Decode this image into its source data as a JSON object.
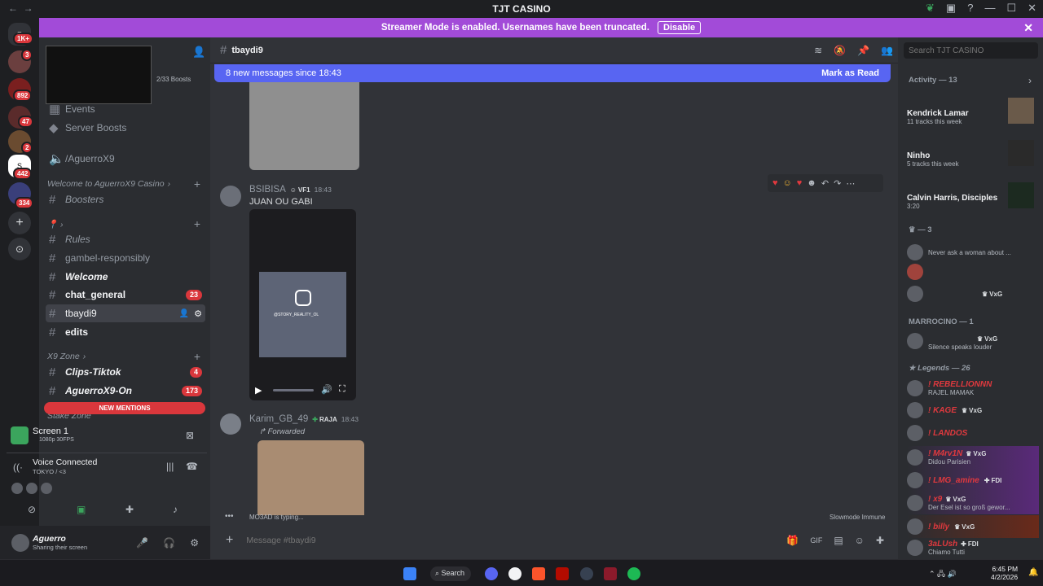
{
  "window": {
    "title": "TJT CASINO"
  },
  "banner": {
    "text": "Streamer Mode is enabled. Usernames have been truncated.",
    "disable_label": "Disable"
  },
  "rail": {
    "home_badge": "1K+",
    "badges": [
      "3",
      "892",
      "47",
      "2",
      "442",
      "334"
    ]
  },
  "sidebar": {
    "boosts": "2/33 Boosts",
    "items": {
      "events": "Events",
      "server_boosts": "Server Boosts",
      "aguerro": "/AguerroX9",
      "cat_welcome": "Welcome to AguerroX9 Casino",
      "boosters": "Boosters",
      "rules": "Rules",
      "gambel": "gambel-responsibly",
      "welcome": "Welcome",
      "chat_general": "chat_general",
      "chat_general_count": "23",
      "tbaydi9": "tbaydi9",
      "edits": "edits",
      "cat_x9": "X9 Zone",
      "clips": "Clips-Tiktok",
      "clips_count": "4",
      "aguerro_on": "AguerroX9-On",
      "aguerro_on_count": "173",
      "new_mentions": "NEW MENTIONS",
      "stake_zone": "Stake Zone"
    },
    "screen": {
      "title": "Screen 1",
      "quality": "1080p 30FPS"
    },
    "voice": {
      "status": "Voice Connected",
      "channel": "TOKYO / <3"
    },
    "user": {
      "name": "Aguerro",
      "status": "Sharing their screen"
    }
  },
  "main": {
    "channel": "tbaydi9",
    "new_messages": "8 new messages since 18:43",
    "mark_read": "Mark as Read",
    "msg1": {
      "author": "BSIBISA",
      "tag": "VF1",
      "time": "18:43",
      "text": "JUAN OU GABI",
      "video_caption": "@STORY_REALITY_OL"
    },
    "msg2": {
      "author": "Karim_GB_49",
      "tag": "RAJA",
      "time": "18:43",
      "forwarded": "Forwarded"
    },
    "typing": "MO3AD is typing...",
    "slowmode": "Slowmode Immune",
    "composer_placeholder": "Message #tbaydi9"
  },
  "members": {
    "search_placeholder": "Search TJT CASINO",
    "activity_header": "Activity — 13",
    "activities": [
      {
        "name": "Kendrick Lamar",
        "sub": "11 tracks this week"
      },
      {
        "name": "Ninho",
        "sub": "5 tracks this week"
      },
      {
        "name": "Calvin Harris, Disciples",
        "sub": "3:20"
      }
    ],
    "group3": "— 3",
    "g3_members": [
      {
        "name": "",
        "sub": "Never ask a woman about ..."
      },
      {
        "name": "",
        "sub": ""
      },
      {
        "name": "",
        "tag": "VxG",
        "sub": ""
      }
    ],
    "marrocino_header": "MARROCINO — 1",
    "marrocino": {
      "tag": "VxG",
      "sub": "Silence speaks louder"
    },
    "legends_header": "Legends — 26",
    "legends": [
      {
        "name": "! REBELLIONNN",
        "sub": "RAJEL MAMAK",
        "color": "#e0393e"
      },
      {
        "name": "! KAGE",
        "tag": "VxG",
        "sub": "",
        "color": "#e0393e"
      },
      {
        "name": "! LANDOS",
        "sub": "",
        "color": "#e0393e"
      },
      {
        "name": "! M4rv1N",
        "tag": "VxG",
        "sub": "Didou Parisien",
        "color": "#e0393e"
      },
      {
        "name": "! LMG_amine",
        "tag": "FDI",
        "sub": "",
        "color": "#e0393e"
      },
      {
        "name": "! x9",
        "tag": "VxG",
        "sub": "Der Esel ist so groß gewor...",
        "color": "#e0393e"
      },
      {
        "name": "! billy",
        "tag": "VxG",
        "sub": "",
        "color": "#e0393e"
      },
      {
        "name": "3aLUsh",
        "tag": "FDI",
        "sub": "Chiamo Tutti",
        "color": "#e0393e"
      }
    ]
  },
  "taskbar": {
    "search_label": "Search",
    "time": "6:45 PM",
    "date": "4/2/2026"
  }
}
